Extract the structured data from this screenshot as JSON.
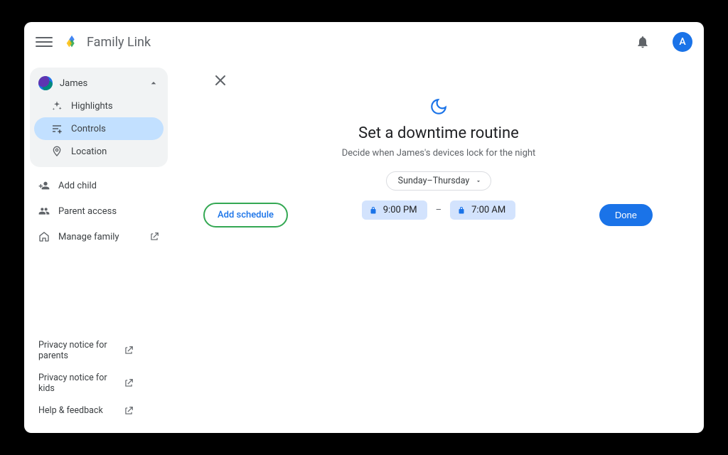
{
  "header": {
    "app_title": "Family Link",
    "avatar_initial": "A"
  },
  "sidebar": {
    "child_name": "James",
    "nav": {
      "highlights": "Highlights",
      "controls": "Controls",
      "location": "Location"
    },
    "add_child": "Add child",
    "parent_access": "Parent access",
    "manage_family": "Manage family",
    "footer": {
      "privacy_parents": "Privacy notice for parents",
      "privacy_kids": "Privacy notice for kids",
      "help": "Help & feedback"
    }
  },
  "main": {
    "title": "Set a downtime routine",
    "description": "Decide when James's devices lock for the night",
    "day_range": "Sunday–Thursday",
    "start_time": "9:00 PM",
    "end_time": "7:00 AM",
    "add_schedule": "Add schedule",
    "done": "Done"
  }
}
